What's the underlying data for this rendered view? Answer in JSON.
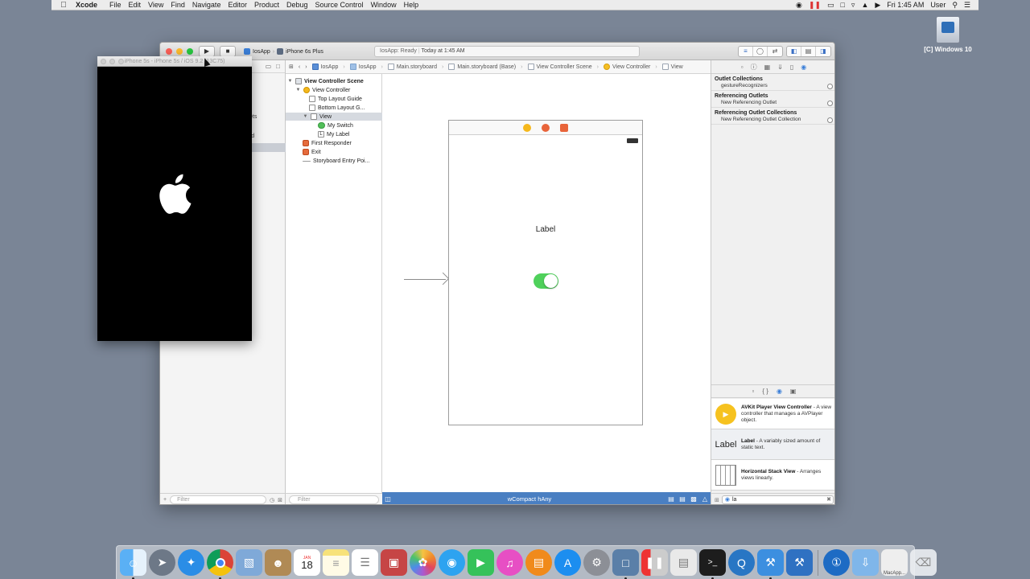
{
  "menubar": {
    "app": "Xcode",
    "items": [
      "File",
      "Edit",
      "View",
      "Find",
      "Navigate",
      "Editor",
      "Product",
      "Debug",
      "Source Control",
      "Window",
      "Help"
    ],
    "clock": "Fri 1:45 AM",
    "user": "User"
  },
  "desktop": {
    "icon_label": "[C] Windows 10"
  },
  "toolbar": {
    "scheme": "IosApp",
    "device": "iPhone 6s Plus",
    "status_app": "IosApp: Ready",
    "status_time": "Today at 1:45 AM"
  },
  "navigator": {
    "fragments": [
      "ets",
      "ard"
    ],
    "filter_placeholder": "Filter"
  },
  "jumpbar": {
    "crumbs": [
      "IosApp",
      "IosApp",
      "Main.storyboard",
      "Main.storyboard (Base)",
      "View Controller Scene",
      "View Controller",
      "View"
    ]
  },
  "outline": {
    "rows": [
      {
        "label": "View Controller Scene",
        "level": 0,
        "icon": "scene",
        "bold": true
      },
      {
        "label": "View Controller",
        "level": 1,
        "icon": "yel"
      },
      {
        "label": "Top Layout Guide",
        "level": 2,
        "icon": "guide"
      },
      {
        "label": "Bottom Layout G...",
        "level": 2,
        "icon": "guide"
      },
      {
        "label": "View",
        "level": 2,
        "icon": "view",
        "selected": true
      },
      {
        "label": "My Switch",
        "level": 3,
        "icon": "sw"
      },
      {
        "label": "My Label",
        "level": 3,
        "icon": "lbl"
      },
      {
        "label": "First Responder",
        "level": 1,
        "icon": "or"
      },
      {
        "label": "Exit",
        "level": 1,
        "icon": "or"
      },
      {
        "label": "Storyboard Entry Poi...",
        "level": 1,
        "icon": "entry"
      }
    ],
    "filter_placeholder": "Filter"
  },
  "canvas": {
    "label_text": "Label",
    "size_class": "wCompact hAny",
    "switch_on": true
  },
  "inspector": {
    "sections": [
      {
        "title": "Outlet Collections",
        "rows": [
          "gestureRecognizers"
        ]
      },
      {
        "title": "Referencing Outlets",
        "rows": [
          "New Referencing Outlet"
        ]
      },
      {
        "title": "Referencing Outlet Collections",
        "rows": [
          "New Referencing Outlet Collection"
        ]
      }
    ]
  },
  "library": {
    "items": [
      {
        "name": "AVKit Player View Controller",
        "desc": "A view controller that manages a AVPlayer object."
      },
      {
        "name": "Label",
        "desc": "A variably sized amount of static text.",
        "thumb_text": "Label"
      },
      {
        "name": "Horizontal Stack View",
        "desc": "Arranges views linearly."
      }
    ],
    "filter_value": "la"
  },
  "simulator": {
    "title": "iPhone 5s - iPhone 5s / iOS 9.2 (13C75)"
  },
  "dock": {
    "apps": [
      "finder",
      "launchpad",
      "safari",
      "chrome",
      "preview",
      "contacts",
      "calendar",
      "notes",
      "reminders",
      "photo-booth",
      "photos",
      "messages",
      "facetime",
      "itunes",
      "ibooks",
      "app-store",
      "system-preferences",
      "simulator",
      "xcode-helper",
      "window",
      "terminal",
      "quicktime",
      "xcode",
      "xcode-alt",
      "onepassword",
      "downloads",
      "macapp",
      "trash"
    ],
    "calendar_day": "18",
    "calendar_month": "JAN",
    "macapp_label": "MacApp..."
  }
}
